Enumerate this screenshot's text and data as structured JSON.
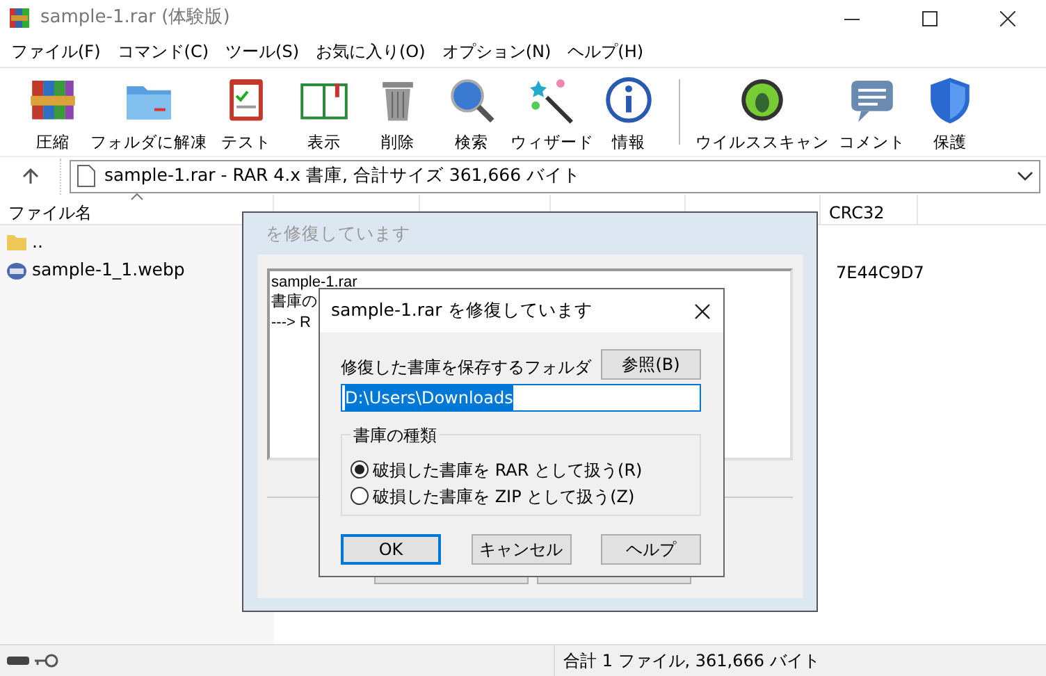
{
  "window": {
    "title": "sample-1.rar (体験版)"
  },
  "menu": [
    "ファイル(F)",
    "コマンド(C)",
    "ツール(S)",
    "お気に入り(O)",
    "オプション(N)",
    "ヘルプ(H)"
  ],
  "toolbar": [
    [
      "圧縮",
      "フォルダに解凍",
      "テスト",
      "表示",
      "削除",
      "検索",
      "ウィザード",
      "情報"
    ],
    [
      "ウイルススキャン",
      "コメント",
      "保護"
    ]
  ],
  "address": {
    "text": "sample-1.rar - RAR 4.x 書庫, 合計サイズ 361,666 バイト"
  },
  "columns": [
    {
      "label": "ファイル名",
      "sorted": true
    },
    {
      "label": "CRC32",
      "sorted": false
    }
  ],
  "rows": [
    {
      "name": "..",
      "kind": "folder"
    },
    {
      "name": "sample-1_1.webp",
      "kind": "image",
      "crc": "7E44C9D7"
    }
  ],
  "status_bar": {
    "text": "合計 1 ファイル, 361,666 バイト"
  },
  "progress_dialog": {
    "title": "を修復しています",
    "log": [
      "sample-1.rar",
      "書庫の",
      "---> R"
    ]
  },
  "repair_dialog": {
    "title": "sample-1.rar を修復しています",
    "folder_label": "修復した書庫を保存するフォルダ",
    "browse_button": "参照(B)",
    "folder_value": "D:\\Users\\Downloads",
    "group_label": "書庫の種類",
    "options": [
      {
        "label": "破損した書庫を RAR として扱う(R)",
        "selected": true
      },
      {
        "label": "破損した書庫を ZIP として扱う(Z)",
        "selected": false
      }
    ],
    "buttons": [
      {
        "label": "OK",
        "default": true
      },
      {
        "label": "キャンセル",
        "default": false
      },
      {
        "label": "ヘルプ",
        "default": false
      }
    ]
  }
}
